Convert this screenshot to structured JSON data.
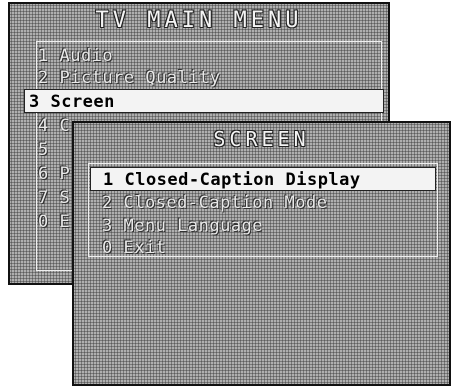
{
  "main_menu": {
    "title": "TV MAIN MENU",
    "items": [
      {
        "label": "1 Audio"
      },
      {
        "label": "2 Picture Quality"
      },
      {
        "label": "3 Screen"
      },
      {
        "label": "4 C"
      },
      {
        "label": "5"
      },
      {
        "label": "6 P"
      },
      {
        "label": "7 S"
      },
      {
        "label": "0 E"
      }
    ],
    "selected_index": 2
  },
  "screen_menu": {
    "title": "SCREEN",
    "items": [
      {
        "label": "1 Closed-Caption Display"
      },
      {
        "label": "2 Closed-Caption Mode"
      },
      {
        "label": "3 Menu Language"
      },
      {
        "label": "0 Exit"
      }
    ],
    "selected_index": 0
  }
}
